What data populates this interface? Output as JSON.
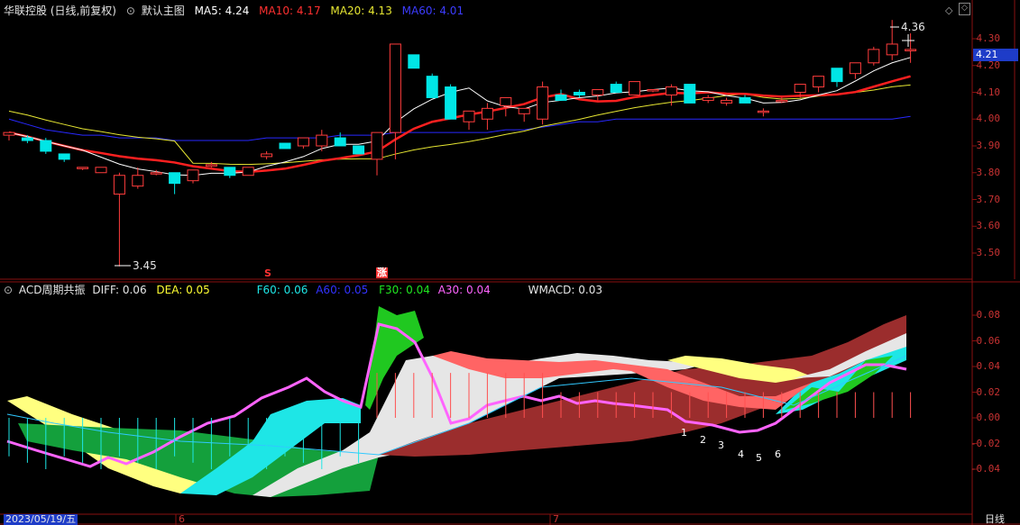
{
  "header": {
    "stock_name": "华联控股 (日线,前复权)",
    "template": "默认主图",
    "ma5": "MA5: 4.24",
    "ma10": "MA10: 4.17",
    "ma20": "MA20: 4.13",
    "ma60": "MA60: 4.01"
  },
  "indicator_header": {
    "name": "ACD周期共振",
    "diff": "DIFF: 0.06",
    "dea": "DEA: 0.05",
    "f60": "F60: 0.06",
    "a60": "A60: 0.05",
    "f30": "F30: 0.04",
    "a30": "A30: 0.04",
    "wmacd": "WMACD: 0.03"
  },
  "colors": {
    "ma5": "#ffffff",
    "ma10": "#ff2020",
    "ma20": "#e6e632",
    "ma60": "#2828ff",
    "up": "#ff3c3c",
    "down": "#00e6e6",
    "axis": "#c83232"
  },
  "price_axis": [
    "4.30",
    "4.20",
    "4.10",
    "4.00",
    "3.90",
    "3.80",
    "3.70",
    "3.60",
    "3.50"
  ],
  "current_price": "4.21",
  "annotations": {
    "high_label": "4.36",
    "low_label": "3.45",
    "signal_s": "S",
    "signal_zhang": "涨"
  },
  "indicator_axis": [
    "0.08",
    "0.06",
    "0.04",
    "0.02",
    "0.00",
    "-0.02",
    "-0.04"
  ],
  "markers": [
    "1",
    "2",
    "3",
    "4",
    "5",
    "6"
  ],
  "footer": {
    "date": "2023/05/19/五",
    "month6": "6",
    "month7": "7",
    "period": "日线"
  },
  "icons": {
    "collapse": "circle-arrow-icon",
    "diamond": "diamond-icon",
    "scroll": "scroll-box-icon"
  },
  "chart_data": {
    "type": "candlestick",
    "price_ylim": [
      3.45,
      4.36
    ],
    "candles": [
      [
        3.94,
        3.95,
        3.92,
        3.95
      ],
      [
        3.93,
        3.94,
        3.91,
        3.92
      ],
      [
        3.92,
        3.93,
        3.87,
        3.88
      ],
      [
        3.87,
        3.87,
        3.84,
        3.85
      ],
      [
        3.82,
        3.82,
        3.81,
        3.82
      ],
      [
        3.8,
        3.82,
        3.8,
        3.82
      ],
      [
        3.72,
        3.8,
        3.45,
        3.79
      ],
      [
        3.75,
        3.82,
        3.74,
        3.79
      ],
      [
        3.8,
        3.81,
        3.79,
        3.8
      ],
      [
        3.8,
        3.8,
        3.72,
        3.76
      ],
      [
        3.77,
        3.81,
        3.76,
        3.81
      ],
      [
        3.83,
        3.84,
        3.82,
        3.83
      ],
      [
        3.82,
        3.82,
        3.78,
        3.79
      ],
      [
        3.79,
        3.82,
        3.79,
        3.82
      ],
      [
        3.86,
        3.88,
        3.85,
        3.87
      ],
      [
        3.91,
        3.91,
        3.89,
        3.89
      ],
      [
        3.9,
        3.93,
        3.89,
        3.93
      ],
      [
        3.9,
        3.96,
        3.88,
        3.94
      ],
      [
        3.93,
        3.95,
        3.9,
        3.9
      ],
      [
        3.9,
        3.9,
        3.87,
        3.87
      ],
      [
        3.85,
        3.95,
        3.79,
        3.95
      ],
      [
        3.95,
        4.28,
        3.85,
        4.28
      ],
      [
        4.24,
        4.24,
        4.19,
        4.19
      ],
      [
        4.16,
        4.17,
        4.08,
        4.08
      ],
      [
        4.12,
        4.13,
        4.0,
        4.0
      ],
      [
        3.99,
        4.03,
        3.96,
        4.03
      ],
      [
        4.0,
        4.06,
        3.96,
        4.04
      ],
      [
        4.05,
        4.08,
        4.01,
        4.08
      ],
      [
        4.02,
        4.04,
        3.99,
        4.04
      ],
      [
        4.0,
        4.14,
        3.98,
        4.12
      ],
      [
        4.09,
        4.11,
        4.07,
        4.07
      ],
      [
        4.1,
        4.11,
        4.08,
        4.09
      ],
      [
        4.09,
        4.11,
        4.07,
        4.11
      ],
      [
        4.13,
        4.14,
        4.1,
        4.1
      ],
      [
        4.09,
        4.14,
        4.09,
        4.14
      ],
      [
        4.11,
        4.11,
        4.1,
        4.11
      ],
      [
        4.09,
        4.13,
        4.05,
        4.12
      ],
      [
        4.13,
        4.13,
        4.06,
        4.06
      ],
      [
        4.07,
        4.09,
        4.06,
        4.08
      ],
      [
        4.06,
        4.08,
        4.05,
        4.07
      ],
      [
        4.08,
        4.09,
        4.06,
        4.06
      ],
      [
        4.03,
        4.04,
        4.01,
        4.03
      ],
      [
        4.07,
        4.08,
        4.06,
        4.07
      ],
      [
        4.1,
        4.13,
        4.08,
        4.13
      ],
      [
        4.12,
        4.16,
        4.1,
        4.16
      ],
      [
        4.19,
        4.19,
        4.12,
        4.14
      ],
      [
        4.17,
        4.21,
        4.15,
        4.21
      ],
      [
        4.21,
        4.27,
        4.2,
        4.26
      ],
      [
        4.24,
        4.37,
        4.22,
        4.28
      ],
      [
        4.26,
        4.32,
        4.21,
        4.26
      ]
    ],
    "ma60": [
      4.0,
      3.98,
      3.96,
      3.95,
      3.94,
      3.94,
      3.93,
      3.93,
      3.93,
      3.92,
      3.92,
      3.92,
      3.92,
      3.92,
      3.93,
      3.93,
      3.93,
      3.93,
      3.94,
      3.94,
      3.94,
      3.95,
      3.95,
      3.95,
      3.95,
      3.95,
      3.95,
      3.96,
      3.96,
      3.97,
      3.98,
      3.99,
      3.99,
      4.0,
      4.0,
      4.0,
      4.0,
      4.0,
      4.0,
      4.0,
      4.0,
      4.0,
      4.0,
      4.0,
      4.0,
      4.0,
      4.0,
      4.0,
      4.0,
      4.01
    ]
  }
}
